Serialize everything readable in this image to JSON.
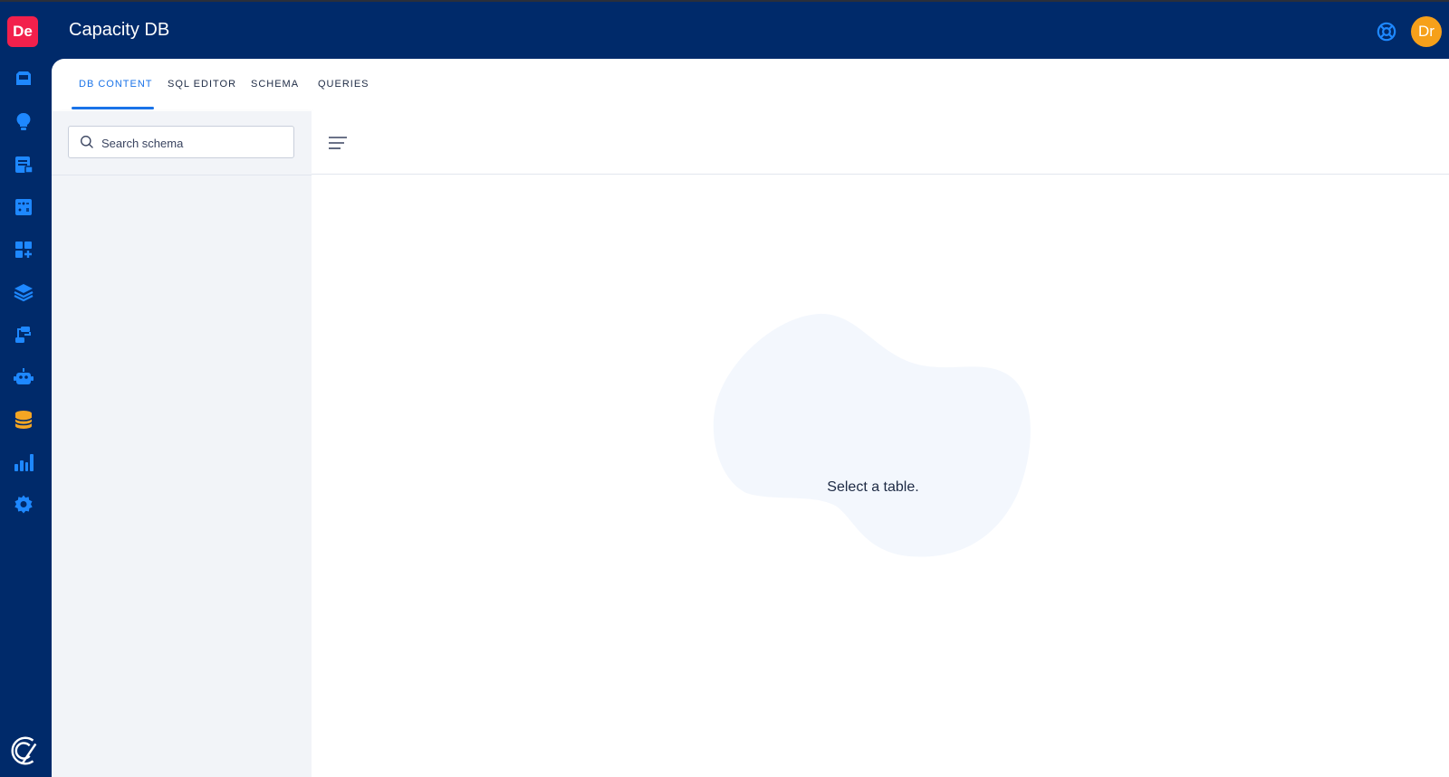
{
  "header": {
    "brand_badge": "De",
    "app_title": "Capacity DB",
    "avatar_initials": "Dr"
  },
  "tabs": [
    {
      "label": "DB CONTENT",
      "active": true
    },
    {
      "label": "SQL EDITOR",
      "active": false
    },
    {
      "label": "SCHEMA",
      "active": false
    },
    {
      "label": "QUERIES",
      "active": false
    }
  ],
  "sidebar": {
    "items": [
      {
        "icon": "inbox-icon"
      },
      {
        "icon": "lightbulb-icon"
      },
      {
        "icon": "document-icon"
      },
      {
        "icon": "calculator-icon"
      },
      {
        "icon": "apps-add-icon"
      },
      {
        "icon": "layers-icon"
      },
      {
        "icon": "workflow-icon"
      },
      {
        "icon": "robot-icon"
      },
      {
        "icon": "database-icon",
        "active": true
      },
      {
        "icon": "bar-chart-icon"
      },
      {
        "icon": "gear-icon"
      }
    ]
  },
  "schema_pane": {
    "search_placeholder": "Search schema"
  },
  "content": {
    "empty_message": "Select a table."
  },
  "colors": {
    "navy": "#002A6A",
    "accent_blue": "#1a73e8",
    "brand_red": "#F2204C",
    "avatar_orange": "#F6A01A",
    "db_active_gold": "#F5A623",
    "icon_blue": "#1E88FF"
  }
}
